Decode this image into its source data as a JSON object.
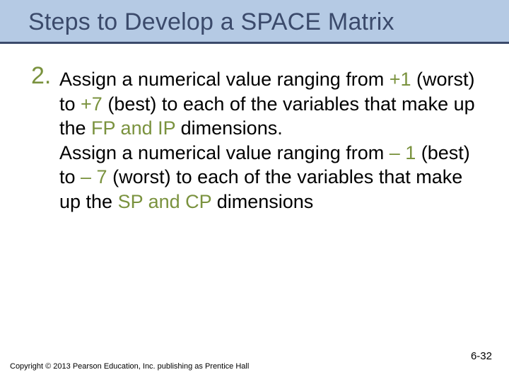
{
  "title": "Steps to Develop a SPACE Matrix",
  "item": {
    "number": "2.",
    "p1_a": "Assign a numerical value ranging from ",
    "p1_hl1": "+1",
    "p1_b": " (worst) to ",
    "p1_hl2": "+7",
    "p1_c": " (best) to each of the variables that make up the ",
    "p1_hl3": "FP and IP",
    "p1_d": " dimensions.",
    "p2_a": "Assign a numerical value ranging from ",
    "p2_hl1": "– 1",
    "p2_b": " (best) to ",
    "p2_hl2": "– 7",
    "p2_c": " (worst) to each of the variables that make up the ",
    "p2_hl3": "SP and CP",
    "p2_d": " dimensions"
  },
  "copyright": "Copyright © 2013 Pearson Education, Inc. publishing as Prentice Hall",
  "pagenum": "6-32"
}
